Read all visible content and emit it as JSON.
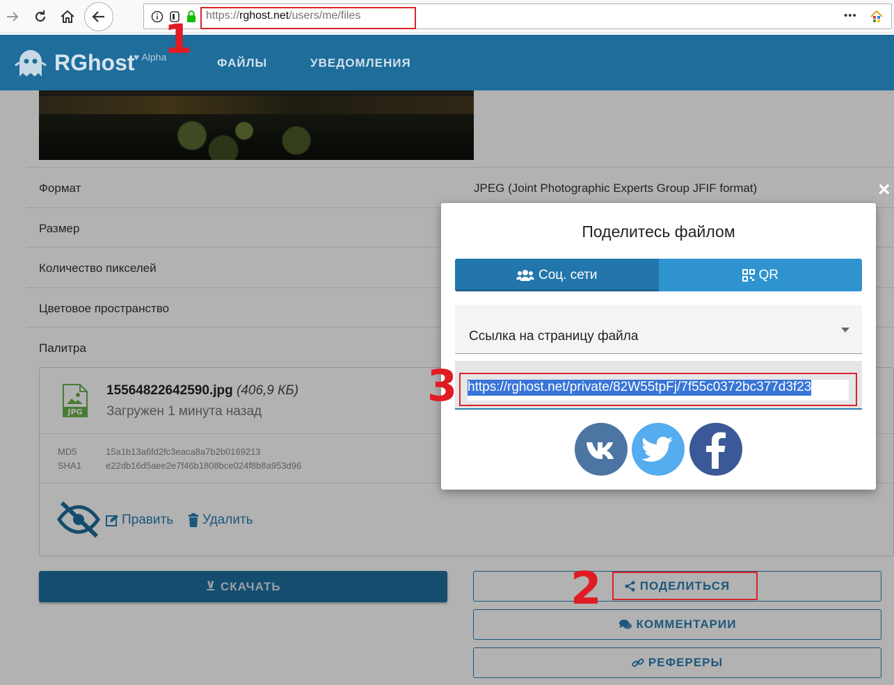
{
  "browser": {
    "url_prefix": "https://",
    "url_domain": "rghost.net",
    "url_path": "/users/me/files",
    "menu_dots": "•••"
  },
  "annotations": {
    "a1": "1",
    "a2": "2",
    "a3": "3"
  },
  "header": {
    "logo": "RGhost",
    "logo_sup": "♥ Alpha",
    "nav": [
      "ФАЙЛЫ",
      "УВЕДОМЛЕНИЯ"
    ]
  },
  "details": {
    "rows": [
      {
        "label": "Формат",
        "value": "JPEG (Joint Photographic Experts Group JFIF format)"
      },
      {
        "label": "Размер",
        "value": ""
      },
      {
        "label": "Количество пикселей",
        "value": ""
      },
      {
        "label": "Цветовое пространство",
        "value": ""
      },
      {
        "label": "Палитра",
        "value": ""
      }
    ]
  },
  "file": {
    "icon_label": "JPG",
    "name": "15564822642590.jpg",
    "size": "(406,9 КБ)",
    "uploaded": "Загружен 1 минута назад",
    "md5_label": "MD5",
    "md5": "15a1b13a6fd2fc3eaca8a7b2b0169213",
    "sha1_label": "SHA1",
    "sha1": "e22db16d5aee2e7f46b1808bce024f8b8a953d96",
    "edit": "Править",
    "delete": "Удалить"
  },
  "buttons": {
    "download": "СКАЧАТЬ",
    "share": "ПОДЕЛИТЬСЯ",
    "comments": "КОММЕНТАРИИ",
    "referrers": "РЕФЕРЕРЫ"
  },
  "modal": {
    "close": "×",
    "title": "Поделитесь файлом",
    "tab_social": "Соц. сети",
    "tab_qr": "QR",
    "select_value": "Ссылка на страницу файла",
    "link": "https://rghost.net/private/82W55tpFj/7f55c0372bc377d3f23",
    "social": [
      "vk",
      "twitter",
      "facebook"
    ]
  },
  "colors": {
    "header": "#1e6d9a",
    "accent": "#2a7db3",
    "annotation": "#d8232a",
    "vk": "#4c75a3",
    "twitter": "#55acee",
    "facebook": "#3b5998"
  }
}
